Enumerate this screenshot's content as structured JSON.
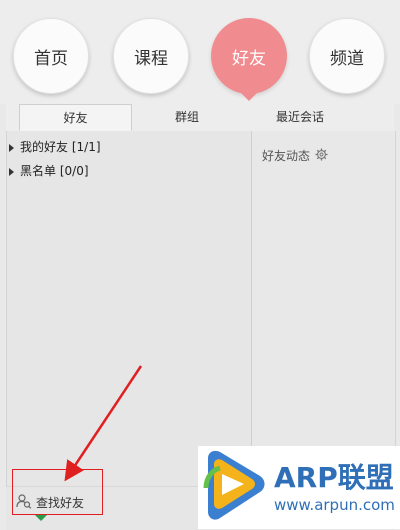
{
  "nav": {
    "items": [
      {
        "label": "首页",
        "active": false
      },
      {
        "label": "课程",
        "active": false
      },
      {
        "label": "好友",
        "active": true
      },
      {
        "label": "频道",
        "active": false
      }
    ],
    "active_color": "#f08c8f"
  },
  "tabs": [
    {
      "label": "好友",
      "active": true
    },
    {
      "label": "群组",
      "active": false
    },
    {
      "label": "最近会话",
      "active": false
    }
  ],
  "friend_groups": [
    {
      "name": "我的好友",
      "count": "[1/1]"
    },
    {
      "name": "黑名单",
      "count": "[0/0]"
    }
  ],
  "feed": {
    "title": "好友动态",
    "icon": "gear-icon"
  },
  "bottom": {
    "find_friends": "查找好友",
    "icon": "find-friend-icon"
  },
  "annotation": {
    "color": "#e02020"
  },
  "watermark": {
    "brand": "ARP联盟",
    "url": "www.arpun.com",
    "color": "#2f6fb7"
  }
}
